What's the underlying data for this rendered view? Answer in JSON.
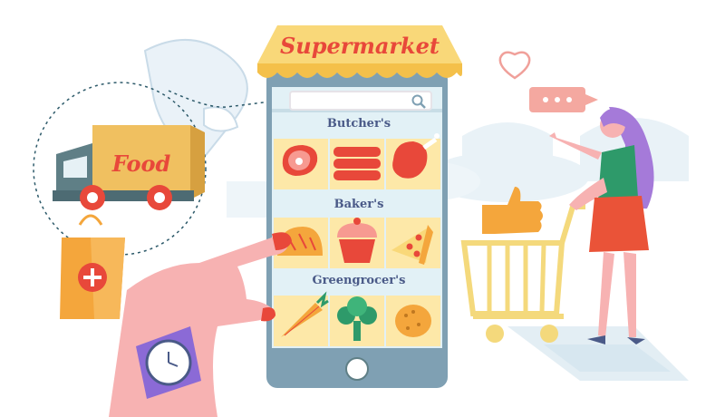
{
  "store": {
    "title": "Supermarket",
    "search": {
      "value": "",
      "icon": "search-icon"
    }
  },
  "truck": {
    "label": "Food"
  },
  "sections": [
    {
      "title": "Butcher's",
      "items": [
        "steak-icon",
        "sausages-icon",
        "chicken-leg-icon"
      ]
    },
    {
      "title": "Baker's",
      "items": [
        "bread-icon",
        "cupcake-icon",
        "pizza-slice-icon"
      ]
    },
    {
      "title": "Greengrocer's",
      "items": [
        "carrot-icon",
        "broccoli-icon",
        "potato-icon"
      ]
    }
  ],
  "speech_bubble": {
    "text": "..."
  },
  "colors": {
    "brand_red": "#e8483a",
    "awning_yellow": "#f9d879",
    "phone_body": "#7fa0b3",
    "screen_bg": "#e2f1f6",
    "tile_bg": "#fde8a8",
    "truck_cab": "#5f7f86",
    "truck_cargo": "#f0c060",
    "hair_purple": "#a57ad9",
    "skirt_red": "#ea5338",
    "top_green": "#2e9a6a",
    "cart_yellow": "#f4d97c",
    "section_title": "#4a5a88"
  }
}
